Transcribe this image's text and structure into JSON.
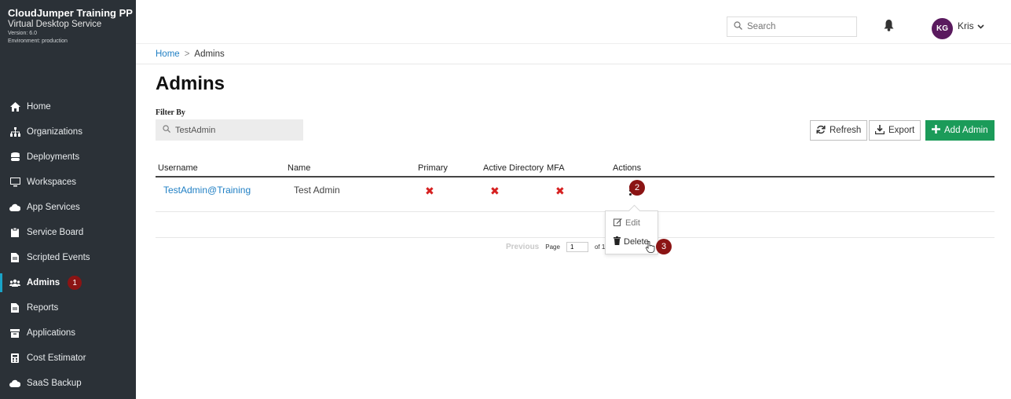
{
  "sidebar": {
    "brand_title": "CloudJumper Training PP",
    "brand_subtitle": "Virtual Desktop Service",
    "version": "Version: 6.0",
    "environment": "Environment: production",
    "items": [
      {
        "label": "Home",
        "icon": "home-icon"
      },
      {
        "label": "Organizations",
        "icon": "sitemap-icon"
      },
      {
        "label": "Deployments",
        "icon": "database-icon"
      },
      {
        "label": "Workspaces",
        "icon": "desktop-icon"
      },
      {
        "label": "App Services",
        "icon": "cloud-icon"
      },
      {
        "label": "Service Board",
        "icon": "clipboard-icon"
      },
      {
        "label": "Scripted Events",
        "icon": "file-icon"
      },
      {
        "label": "Admins",
        "icon": "users-icon"
      },
      {
        "label": "Reports",
        "icon": "file-icon"
      },
      {
        "label": "Applications",
        "icon": "archive-icon"
      },
      {
        "label": "Cost Estimator",
        "icon": "calculator-icon"
      },
      {
        "label": "SaaS Backup",
        "icon": "cloud-icon"
      }
    ],
    "admins_badge": "1"
  },
  "topbar": {
    "search_placeholder": "Search",
    "avatar_initials": "KG",
    "user_name": "Kris"
  },
  "breadcrumb": {
    "home": "Home",
    "separator": ">",
    "current": "Admins"
  },
  "page": {
    "title": "Admins",
    "filter_label": "Filter By",
    "filter_value": "TestAdmin"
  },
  "toolbar": {
    "refresh_label": "Refresh",
    "export_label": "Export",
    "add_label": "Add Admin"
  },
  "table": {
    "headers": [
      "Username",
      "Name",
      "Primary",
      "Active Directory",
      "MFA",
      "Actions"
    ],
    "rows": [
      {
        "username": "TestAdmin@Training",
        "name": "Test Admin",
        "primary": "✖",
        "active_directory": "✖",
        "mfa": "✖"
      }
    ]
  },
  "pager": {
    "previous": "Previous",
    "page_label": "Page",
    "page_value": "1",
    "of_label": "of 1"
  },
  "action_menu": {
    "edit_label": "Edit",
    "delete_label": "Delete"
  },
  "steps": {
    "kebab_step": "2",
    "delete_step": "3"
  },
  "colors": {
    "sidebar_bg": "#2b3137",
    "accent_blue": "#1f7fc4",
    "add_button_green": "#1b9b59",
    "step_badge": "#8b1414",
    "x_red": "#d62020"
  }
}
